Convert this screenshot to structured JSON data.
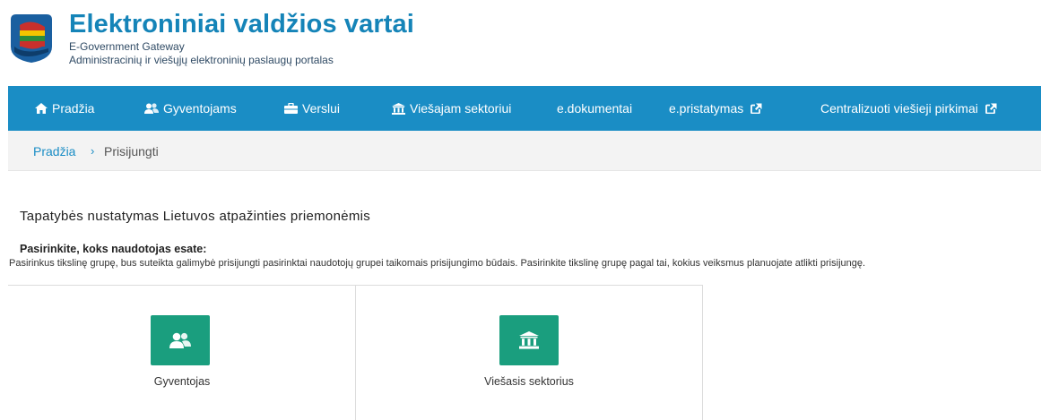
{
  "header": {
    "title": "Elektroniniai valdžios vartai",
    "subtitle": "E-Government Gateway",
    "tagline": "Administracinių ir viešųjų elektroninių paslaugų portalas"
  },
  "nav": {
    "items": [
      {
        "label": "Pradžia",
        "icon": "home-icon"
      },
      {
        "label": "Gyventojams",
        "icon": "users-icon"
      },
      {
        "label": "Verslui",
        "icon": "briefcase-icon"
      },
      {
        "label": "Viešajam sektoriui",
        "icon": "institution-icon"
      },
      {
        "label": "e.dokumentai",
        "icon": ""
      },
      {
        "label": "e.pristatymas",
        "icon": "external-link-icon"
      },
      {
        "label": "Centralizuoti viešieji pirkimai",
        "icon": "external-link-icon"
      }
    ]
  },
  "breadcrumb": {
    "home": "Pradžia",
    "separator": "›",
    "current": "Prisijungti"
  },
  "main": {
    "heading": "Tapatybės nustatymas Lietuvos atpažinties priemonėmis",
    "choose_heading": "Pasirinkite, koks naudotojas esate:",
    "choose_description": "Pasirinkus tikslinę grupę, bus suteikta galimybė prisijungti pasirinktai naudotojų grupei taikomais prisijungimo būdais. Pasirinkite tikslinę grupę pagal tai, kokius veiksmus planuojate atlikti prisijungę.",
    "cards": [
      {
        "label": "Gyventojas",
        "icon": "users-icon"
      },
      {
        "label": "Viešasis sektorius",
        "icon": "institution-icon"
      }
    ]
  },
  "colors": {
    "brand_blue": "#1a8dc5",
    "title_blue": "#1584b8",
    "card_green": "#1a9e7e",
    "breadcrumb_bg": "#f3f3f3"
  }
}
